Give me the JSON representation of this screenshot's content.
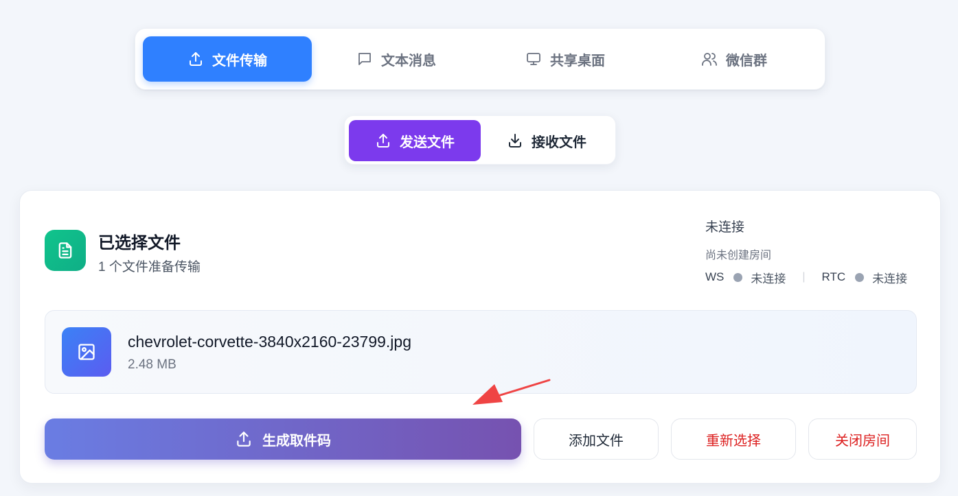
{
  "top_tabs": [
    {
      "label": "文件传输",
      "icon": "upload-icon",
      "active": true
    },
    {
      "label": "文本消息",
      "icon": "message-icon",
      "active": false
    },
    {
      "label": "共享桌面",
      "icon": "monitor-icon",
      "active": false
    },
    {
      "label": "微信群",
      "icon": "users-icon",
      "active": false
    }
  ],
  "sub_tabs": [
    {
      "label": "发送文件",
      "icon": "upload-icon",
      "active": true
    },
    {
      "label": "接收文件",
      "icon": "download-icon",
      "active": false
    }
  ],
  "card": {
    "title": "已选择文件",
    "subtitle": "1 个文件准备传输",
    "icon": "document-icon"
  },
  "status": {
    "title": "未连接",
    "room": "尚未创建房间",
    "ws_label": "WS",
    "ws_state": "未连接",
    "separator": "|",
    "rtc_label": "RTC",
    "rtc_state": "未连接"
  },
  "file": {
    "name": "chevrolet-corvette-3840x2160-23799.jpg",
    "size": "2.48 MB",
    "icon": "image-icon"
  },
  "actions": {
    "generate": "生成取件码",
    "add": "添加文件",
    "reselect": "重新选择",
    "close": "关闭房间"
  },
  "colors": {
    "primary_blue": "#2f80ff",
    "purple": "#7c3aed",
    "green": "#10c48c",
    "danger": "#dc1f1f",
    "annotation_arrow": "#ef4444"
  }
}
